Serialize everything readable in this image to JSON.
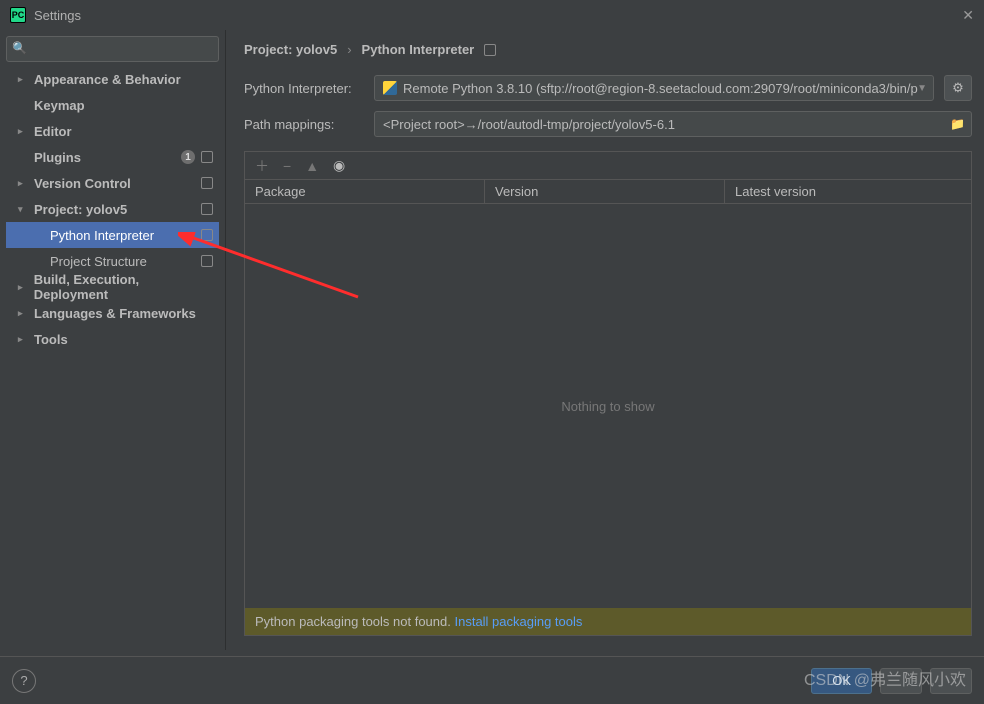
{
  "titlebar": {
    "title": "Settings"
  },
  "search": {
    "placeholder": ""
  },
  "tree": {
    "appearance": "Appearance & Behavior",
    "keymap": "Keymap",
    "editor": "Editor",
    "plugins": "Plugins",
    "vcs": "Version Control",
    "project": "Project: yolov5",
    "pyinterp": "Python Interpreter",
    "projstruct": "Project Structure",
    "build": "Build, Execution, Deployment",
    "lang": "Languages & Frameworks",
    "tools": "Tools"
  },
  "crumbs": {
    "a": "Project: yolov5",
    "b": "Python Interpreter"
  },
  "interp": {
    "label": "Python Interpreter:",
    "value": "Remote Python 3.8.10 (sftp://root@region-8.seetacloud.com:29079/root/miniconda3/bin/p"
  },
  "pathmap": {
    "label": "Path mappings:",
    "value": "<Project root>→/root/autodl-tmp/project/yolov5-6.1"
  },
  "cols": {
    "pkg": "Package",
    "ver": "Version",
    "lat": "Latest version"
  },
  "empty": "Nothing to show",
  "footer": {
    "msg": "Python packaging tools not found. ",
    "link": "Install packaging tools"
  },
  "btns": {
    "ok": "OK"
  },
  "watermark": "CSDN @弗兰随风小欢"
}
